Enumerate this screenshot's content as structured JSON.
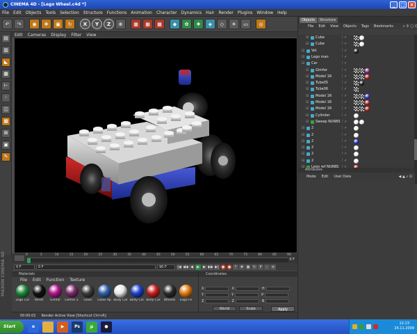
{
  "window": {
    "title": "CINEMA 4D - [Lego Wheel.c4d *]"
  },
  "menubar": [
    "File",
    "Edit",
    "Objects",
    "Tools",
    "Selection",
    "Structure",
    "Functions",
    "Animation",
    "Character",
    "Dynamics",
    "Hair",
    "Render",
    "Plugins",
    "Window",
    "Help"
  ],
  "toolbar": {
    "axis_x": "X",
    "axis_y": "Y",
    "axis_z": "Z"
  },
  "viewport": {
    "menu": [
      "Edit",
      "Cameras",
      "Display",
      "Filter",
      "View"
    ]
  },
  "timeline": {
    "ticks": [
      "0",
      "5",
      "10",
      "15",
      "20",
      "25",
      "30",
      "35",
      "40",
      "45",
      "50",
      "55",
      "60",
      "65",
      "70",
      "75",
      "80",
      "85",
      "90"
    ],
    "end_label": "0 F",
    "start_field": "0 F",
    "current_field": "0 F",
    "end_field": "90 F"
  },
  "materials": {
    "header": "Materials",
    "menu": [
      "File",
      "Edit",
      "Function",
      "Texture"
    ],
    "items": [
      {
        "label": "Lego Car",
        "color": "#1f8a3a"
      },
      {
        "label": "Reset",
        "color": "#111111"
      },
      {
        "label": "Gimfar",
        "color": "#b0148a"
      },
      {
        "label": "Gimfar 2",
        "color": "#7a2a6a"
      },
      {
        "label": "Glass",
        "color": "#3a3a3a"
      },
      {
        "label": "Glass Ap",
        "color": "#2f5fa8"
      },
      {
        "label": "Body Car",
        "color": "#e8e8e8"
      },
      {
        "label": "Body Car",
        "color": "#1c3fc8"
      },
      {
        "label": "Body Car",
        "color": "#c81c1c"
      },
      {
        "label": "Wheels",
        "color": "#2a2a2a"
      },
      {
        "label": "Lego Fe",
        "color": "#e07a10"
      }
    ]
  },
  "coordinates": {
    "header": "Coordinates",
    "col1": [
      "X",
      "Y",
      "Z"
    ],
    "col2": [
      "X",
      "Y",
      "Z"
    ],
    "col3": [
      "H",
      "P",
      "B"
    ],
    "dropdown1": "World",
    "dropdown2": "Scale",
    "apply": "Apply"
  },
  "status": {
    "time": "00:00:02",
    "message": "Render Active View [Shortcut Ctrl+R]"
  },
  "objects": {
    "tabs": [
      "Objects",
      "Structure"
    ],
    "menu": [
      "File",
      "Edit",
      "View",
      "Objects",
      "Tags",
      "Bookmarks"
    ],
    "rows": [
      {
        "name": "Cube",
        "indent": 2,
        "tags": [
          "check",
          "ball-white"
        ]
      },
      {
        "name": "Cube",
        "indent": 2,
        "tags": [
          "check",
          "ball-white"
        ]
      },
      {
        "name": "Vol",
        "indent": 1,
        "tags": [
          "ball-black"
        ]
      },
      {
        "name": "Lego man",
        "indent": 1,
        "tags": []
      },
      {
        "name": "Car",
        "indent": 1,
        "tags": []
      },
      {
        "name": "Gimfar",
        "indent": 2,
        "tags": [
          "check",
          "check",
          "ball-purple"
        ]
      },
      {
        "name": "Model 1R",
        "indent": 2,
        "tags": [
          "check",
          "check",
          "ball-red"
        ]
      },
      {
        "name": "Tube05",
        "indent": 2,
        "tags": [
          "check",
          "ball-black"
        ]
      },
      {
        "name": "Tube06",
        "indent": 2,
        "tags": [
          "check"
        ]
      },
      {
        "name": "Model 1R",
        "indent": 2,
        "tags": [
          "check",
          "check",
          "ball-blue"
        ]
      },
      {
        "name": "Model 1R",
        "indent": 2,
        "tags": [
          "check",
          "check",
          "ball-red"
        ]
      },
      {
        "name": "Model 1R",
        "indent": 2,
        "tags": [
          "check",
          "check",
          "ball-red"
        ]
      },
      {
        "name": "Cylinder",
        "indent": 2,
        "tags": [
          "ball-white"
        ]
      },
      {
        "name": "Sweep NURBS",
        "indent": 2,
        "tags": [
          "ball-white",
          "ball-white"
        ]
      },
      {
        "name": "2",
        "indent": 1,
        "tags": [
          "ball-white"
        ]
      },
      {
        "name": "2",
        "indent": 1,
        "tags": [
          "ball-white"
        ]
      },
      {
        "name": "2",
        "indent": 1,
        "tags": [
          "ball-blue"
        ]
      },
      {
        "name": "2",
        "indent": 1,
        "tags": [
          "ball-white"
        ]
      },
      {
        "name": "2",
        "indent": 1,
        "tags": [
          "ball-white"
        ]
      },
      {
        "name": "2",
        "indent": 1,
        "tags": [
          "ball-white"
        ]
      },
      {
        "name": "Lego ref NURBS",
        "indent": 1,
        "tags": [
          "ball-red"
        ]
      }
    ]
  },
  "attributes": {
    "header": "Attributes",
    "menu": [
      "Mode",
      "Edit",
      "User Data"
    ]
  },
  "taskbar": {
    "start": "Start",
    "apps": [
      {
        "name": "ie",
        "color": "#2a6ad8",
        "glyph": "e"
      },
      {
        "name": "folder",
        "color": "#e0b040",
        "glyph": ""
      },
      {
        "name": "media",
        "color": "#d06020",
        "glyph": "▶"
      },
      {
        "name": "photoshop",
        "color": "#1c3a6a",
        "glyph": "Ps"
      },
      {
        "name": "utorrent",
        "color": "#3aa83a",
        "glyph": "µ"
      },
      {
        "name": "cinema4d",
        "color": "#1a1a3a",
        "glyph": "●"
      }
    ],
    "clock_time": "12:13",
    "clock_date": "24.11.2009"
  },
  "side_logo": "MAXON CINEMA 4D"
}
